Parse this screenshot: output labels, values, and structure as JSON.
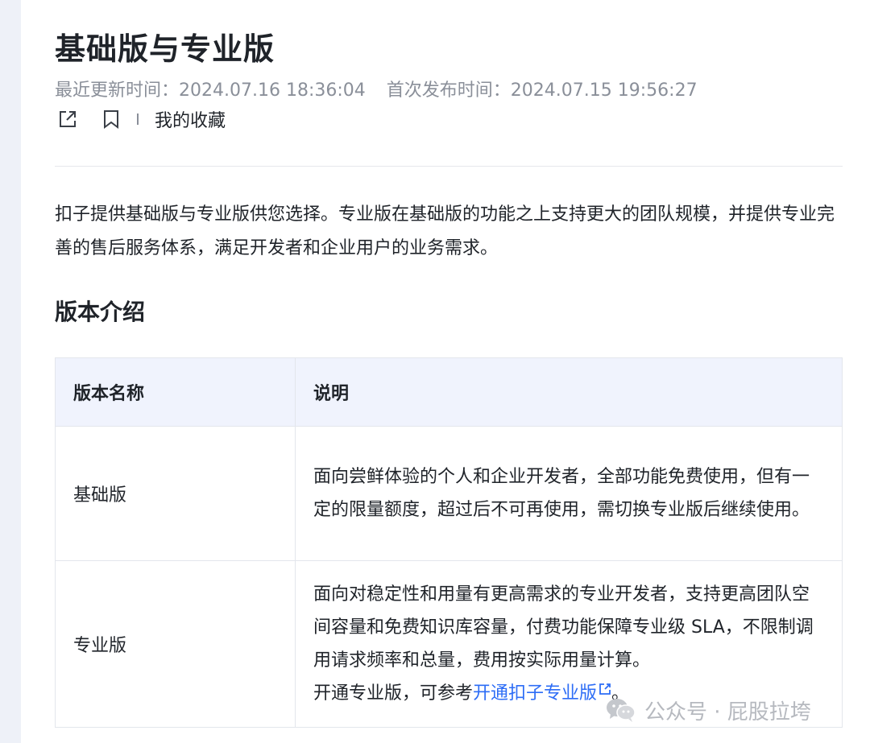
{
  "page": {
    "title": "基础版与专业版",
    "updated_label": "最近更新时间：",
    "updated_time": "2024.07.16 18:36:04",
    "published_label": "首次发布时间：",
    "published_time": "2024.07.15 19:56:27",
    "favorite_label": "我的收藏"
  },
  "icons": {
    "share": "share-icon",
    "bookmark": "bookmark-icon",
    "external_link": "external-link-icon",
    "wechat": "wechat-icon"
  },
  "intro": {
    "text": "扣子提供基础版与专业版供您选择。专业版在基础版的功能之上支持更大的团队规模，并提供专业完善的售后服务体系，满足开发者和企业用户的业务需求。"
  },
  "section": {
    "title": "版本介绍"
  },
  "table": {
    "headers": [
      "版本名称",
      "说明"
    ],
    "rows": [
      {
        "name": "基础版",
        "description": "面向尝鲜体验的个人和企业开发者，全部功能免费使用，但有一定的限量额度，超过后不可再使用，需切换专业版后继续使用。"
      },
      {
        "name": "专业版",
        "description": "面向对稳定性和用量有更高需求的专业开发者，支持更高团队空间容量和免费知识库容量，付费功能保障专业级 SLA，不限制调用请求频率和总量，费用按实际用量计算。",
        "note_prefix": "开通专业版，可参考",
        "note_link": "开通扣子专业版",
        "note_suffix": "。"
      }
    ]
  },
  "watermark": {
    "text": "公众号 · 屁股拉垮"
  },
  "colors": {
    "link": "#2d6df6",
    "header_bg": "#f0f3fd",
    "meta_text": "#8a8f99"
  }
}
